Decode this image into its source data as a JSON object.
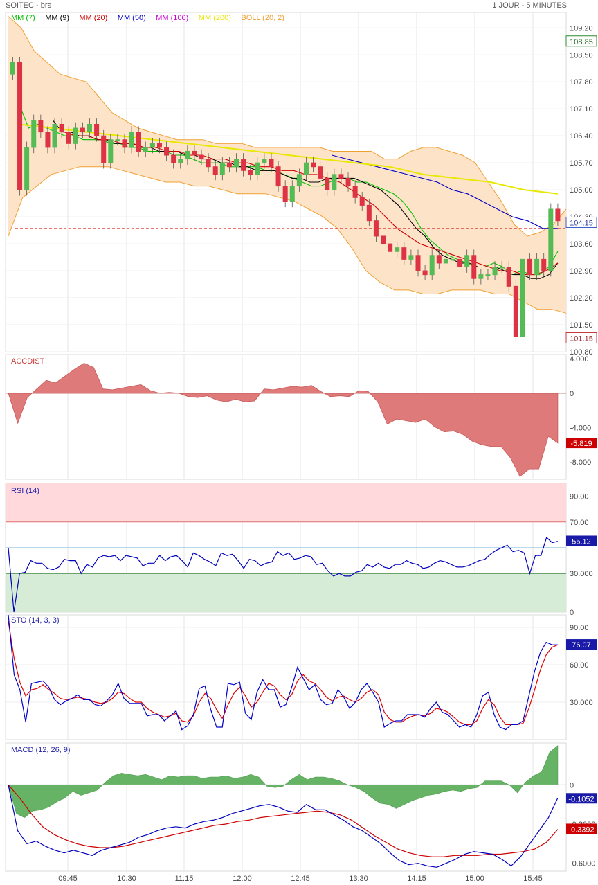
{
  "header": {
    "instrument": "SOITEC - brs",
    "timeframe": "1 JOUR - 5 MINUTES"
  },
  "legend": [
    {
      "label": "MM (7)",
      "color": "#00c000"
    },
    {
      "label": "MM (9)",
      "color": "#000000"
    },
    {
      "label": "MM (20)",
      "color": "#d00000"
    },
    {
      "label": "MM (50)",
      "color": "#0000c0"
    },
    {
      "label": "MM (100)",
      "color": "#d000d0"
    },
    {
      "label": "MM (200)",
      "color": "#e8e800"
    },
    {
      "label": "BOLL (20, 2)",
      "color": "#f0a030"
    }
  ],
  "colors": {
    "up": "#55bb55",
    "down": "#dd3344",
    "bollinger_fill": "#fde3c8",
    "bollinger_line": "#f0a030",
    "accdist_fill": "#df7a7a",
    "rsi_line": "#0000bb",
    "rsi_over": "#ffd9dc",
    "rsi_under": "#d6ecd6",
    "stoch_k": "#0000cc",
    "stoch_d": "#dd0000",
    "macd_hist": "#66b366",
    "macd_line": "#0000bb",
    "macd_signal": "#cc0000"
  },
  "chart_data": {
    "type": "line",
    "time_labels": [
      "09:45",
      "10:30",
      "11:15",
      "12:00",
      "12:45",
      "13:30",
      "14:15",
      "15:00",
      "15:45"
    ],
    "price_panel": {
      "ylim": [
        100.8,
        109.6
      ],
      "ticks": [
        "109.20",
        "108.50",
        "107.80",
        "107.10",
        "106.40",
        "105.70",
        "105.00",
        "104.30",
        "103.60",
        "102.90",
        "102.20",
        "101.50",
        "100.80"
      ],
      "last_price": "108.85",
      "current_price": "104.15",
      "low_marker": "101.15",
      "reference_level": 104.0,
      "close_series": [
        108.3,
        105.0,
        106.1,
        106.8,
        106.5,
        106.1,
        106.7,
        106.5,
        106.2,
        106.6,
        106.5,
        106.7,
        106.4,
        105.7,
        106.3,
        106.3,
        106.1,
        106.5,
        106.0,
        106.1,
        106.2,
        106.1,
        105.9,
        105.7,
        105.8,
        106.0,
        105.9,
        105.8,
        105.6,
        105.4,
        105.7,
        105.6,
        105.8,
        105.5,
        105.4,
        105.7,
        105.8,
        105.6,
        105.1,
        104.7,
        105.1,
        105.4,
        105.7,
        105.6,
        105.3,
        105.0,
        105.4,
        105.3,
        105.1,
        104.8,
        104.6,
        104.2,
        103.8,
        103.6,
        103.4,
        103.5,
        103.2,
        103.3,
        102.9,
        102.8,
        103.3,
        103.1,
        103.2,
        103.2,
        103.0,
        103.3,
        102.7,
        102.8,
        102.8,
        103.0,
        103.0,
        102.5,
        101.2,
        103.2,
        102.8,
        103.2,
        102.9,
        104.5,
        104.2
      ],
      "moving_averages": {
        "MM (7)": [
          107.2,
          106.6,
          106.7,
          106.6,
          106.5,
          106.4,
          106.4,
          106.3,
          106.3,
          106.3,
          106.2,
          106.2,
          106.1,
          106.1,
          106.0,
          106.0,
          106.0,
          105.9,
          105.9,
          105.8,
          105.7,
          105.7,
          105.7,
          105.6,
          105.6,
          105.6,
          105.6,
          105.5,
          105.5,
          105.4,
          105.3,
          105.2,
          105.1,
          105.1,
          105.2,
          105.3,
          105.3,
          105.2,
          105.2,
          105.1,
          105.0,
          104.9,
          104.7,
          104.4,
          104.0,
          103.7,
          103.5,
          103.3,
          103.2,
          103.1,
          103.0,
          103.0,
          103.1,
          103.0,
          102.8,
          102.9,
          102.8,
          102.8,
          103.0,
          103.4
        ],
        "MM (9)": [
          106.8,
          106.5,
          106.5,
          106.4,
          106.4,
          106.3,
          106.3,
          106.2,
          106.2,
          106.2,
          106.1,
          106.1,
          106.0,
          106.0,
          106.0,
          105.9,
          105.9,
          105.8,
          105.8,
          105.7,
          105.7,
          105.6,
          105.6,
          105.5,
          105.5,
          105.5,
          105.4,
          105.3,
          105.3,
          105.2,
          105.2,
          105.3,
          105.3,
          105.3,
          105.3,
          105.2,
          105.1,
          105.0,
          104.8,
          104.6,
          104.3,
          104.0,
          103.8,
          103.5,
          103.3,
          103.2,
          103.1,
          103.1,
          103.0,
          103.0,
          103.0,
          102.9,
          102.8,
          102.8,
          102.7,
          102.7,
          102.8,
          103.1
        ],
        "MM (20)": [
          106.5,
          106.4,
          106.4,
          106.3,
          106.3,
          106.2,
          106.2,
          106.1,
          106.1,
          106.0,
          106.0,
          105.9,
          105.9,
          105.8,
          105.8,
          105.7,
          105.7,
          105.6,
          105.6,
          105.5,
          105.5,
          105.4,
          105.4,
          105.3,
          105.2,
          105.0,
          104.8,
          104.6,
          104.3,
          104.0,
          103.8,
          103.6,
          103.5,
          103.4,
          103.3,
          103.2,
          103.1,
          103.0,
          102.9,
          102.9,
          102.8,
          102.8,
          102.9,
          103.1
        ],
        "MM (50)": [
          105.9,
          105.8,
          105.7,
          105.6,
          105.5,
          105.4,
          105.3,
          105.2,
          105.0,
          104.9,
          104.7,
          104.5,
          104.3,
          104.2,
          104.0,
          104.0
        ],
        "MM (200)": [
          106.7,
          106.6,
          106.5,
          106.4,
          106.3,
          106.2,
          106.1,
          106.0,
          105.9,
          105.8,
          105.7,
          105.6,
          105.4,
          105.3,
          105.2,
          105.0,
          104.9
        ]
      },
      "bollinger": {
        "upper": [
          109.5,
          109.2,
          108.6,
          108.3,
          108.0,
          107.9,
          107.8,
          107.4,
          107.0,
          106.8,
          106.6,
          106.5,
          106.4,
          106.3,
          106.3,
          106.3,
          106.2,
          106.2,
          106.2,
          106.1,
          106.1,
          106.1,
          106.1,
          106.1,
          106.1,
          106.0,
          106.0,
          106.0,
          106.0,
          105.8,
          105.8,
          106.0,
          106.1,
          106.1,
          106.0,
          105.9,
          105.7,
          105.2,
          104.7,
          104.1,
          103.8,
          103.9,
          104.1,
          104.5
        ],
        "lower": [
          103.8,
          104.8,
          105.1,
          105.4,
          105.5,
          105.6,
          105.6,
          105.6,
          105.5,
          105.4,
          105.3,
          105.2,
          105.2,
          105.1,
          105.1,
          105.0,
          104.9,
          104.9,
          104.9,
          104.8,
          104.7,
          104.5,
          104.3,
          104.0,
          103.5,
          102.9,
          102.6,
          102.4,
          102.4,
          102.3,
          102.3,
          102.4,
          102.4,
          102.4,
          102.3,
          102.3,
          102.1,
          101.9,
          101.9,
          101.8
        ]
      }
    },
    "accdist_panel": {
      "title": "ACCDIST",
      "ticks": [
        "4.000",
        "0",
        "-4.000",
        "-8.000"
      ],
      "ylim": [
        -10.0,
        4.5
      ],
      "last_value": "-5.819",
      "values": [
        0,
        -3.5,
        -0.5,
        0.5,
        1.5,
        1.2,
        2.0,
        2.8,
        3.5,
        3.0,
        0.5,
        0.4,
        0.6,
        0.8,
        1.0,
        0.3,
        0.0,
        0.1,
        0.0,
        -0.4,
        -0.5,
        -0.3,
        -0.8,
        -1.0,
        -0.7,
        -1.0,
        -0.9,
        0.5,
        0.4,
        0.6,
        0.8,
        0.7,
        0.9,
        0.2,
        -0.4,
        -0.3,
        -0.4,
        0.3,
        0.2,
        -1.0,
        -3.6,
        -3.0,
        -3.2,
        -3.4,
        -3.0,
        -3.9,
        -4.5,
        -4.4,
        -4.8,
        -5.6,
        -6.0,
        -6.2,
        -6.2,
        -7.5,
        -9.7,
        -8.8,
        -8.8,
        -5.0,
        -5.8
      ]
    },
    "rsi_panel": {
      "title": "RSI (14)",
      "ticks": [
        "90.00",
        "70.00",
        "30.000",
        "0"
      ],
      "ylim": [
        0,
        100
      ],
      "overbought": 70,
      "oversold": 30,
      "last_value": "55.12",
      "values": [
        50,
        0,
        30,
        31,
        40,
        38,
        38,
        34,
        33,
        35,
        41,
        40,
        40,
        30,
        37,
        35,
        42,
        44,
        43,
        44,
        40,
        44,
        43,
        42,
        36,
        38,
        38,
        44,
        40,
        43,
        44,
        40,
        35,
        46,
        44,
        41,
        39,
        36,
        46,
        44,
        45,
        40,
        34,
        41,
        40,
        36,
        38,
        39,
        47,
        44,
        46,
        41,
        42,
        44,
        43,
        37,
        38,
        32,
        28,
        30,
        28,
        28,
        31,
        32,
        37,
        35,
        38,
        35,
        34,
        37,
        37,
        40,
        38,
        37,
        34,
        35,
        38,
        40,
        39,
        37,
        35,
        35,
        36,
        38,
        40,
        41,
        45,
        48,
        50,
        52,
        47,
        48,
        46,
        30,
        44,
        44,
        58,
        54,
        55
      ],
      "values_note_sampled": true
    },
    "stoch_panel": {
      "title": "STO (14, 3, 3)",
      "ticks": [
        "90.00",
        "60.00",
        "30.000"
      ],
      "ylim": [
        0,
        100
      ],
      "last_value": "76.07",
      "k_values": [
        100,
        52,
        40,
        14,
        45,
        46,
        47,
        42,
        32,
        28,
        31,
        33,
        36,
        32,
        32,
        28,
        27,
        31,
        36,
        45,
        33,
        29,
        29,
        29,
        19,
        20,
        20,
        15,
        19,
        23,
        8,
        11,
        20,
        41,
        43,
        24,
        10,
        10,
        45,
        44,
        46,
        21,
        16,
        38,
        48,
        40,
        40,
        26,
        28,
        42,
        58,
        49,
        40,
        44,
        32,
        28,
        29,
        40,
        34,
        25,
        30,
        40,
        45,
        38,
        30,
        10,
        13,
        15,
        15,
        20,
        20,
        20,
        18,
        25,
        30,
        22,
        20,
        15,
        10,
        12,
        10,
        20,
        35,
        38,
        20,
        10,
        8,
        12,
        12,
        15,
        35,
        55,
        70,
        78,
        76,
        76
      ],
      "d_values": [
        95,
        65,
        46,
        35,
        40,
        41,
        44,
        40,
        37,
        33,
        32,
        33,
        34,
        33,
        32,
        30,
        29,
        30,
        33,
        38,
        37,
        33,
        30,
        30,
        25,
        22,
        20,
        18,
        19,
        21,
        15,
        14,
        19,
        30,
        37,
        33,
        24,
        17,
        28,
        37,
        42,
        35,
        26,
        30,
        38,
        45,
        43,
        36,
        32,
        36,
        47,
        52,
        47,
        45,
        40,
        34,
        31,
        34,
        35,
        32,
        30,
        33,
        38,
        40,
        36,
        22,
        16,
        14,
        14,
        17,
        19,
        20,
        19,
        21,
        25,
        24,
        22,
        18,
        14,
        12,
        12,
        15,
        25,
        32,
        28,
        18,
        12,
        12,
        12,
        13,
        25,
        40,
        56,
        68,
        74,
        76
      ]
    },
    "macd_panel": {
      "title": "MACD (12, 26, 9)",
      "ticks": [
        "0",
        "-0.3000",
        "-0.6000"
      ],
      "ylim": [
        -0.66,
        0.32
      ],
      "last_macd": "-0.1052",
      "last_signal": "-0.3392",
      "macd_values": [
        0,
        -0.35,
        -0.45,
        -0.43,
        -0.47,
        -0.5,
        -0.52,
        -0.5,
        -0.52,
        -0.54,
        -0.5,
        -0.48,
        -0.46,
        -0.44,
        -0.4,
        -0.38,
        -0.35,
        -0.33,
        -0.32,
        -0.33,
        -0.3,
        -0.28,
        -0.27,
        -0.25,
        -0.22,
        -0.2,
        -0.18,
        -0.16,
        -0.15,
        -0.17,
        -0.2,
        -0.21,
        -0.15,
        -0.19,
        -0.19,
        -0.23,
        -0.27,
        -0.32,
        -0.35,
        -0.4,
        -0.45,
        -0.52,
        -0.58,
        -0.61,
        -0.6,
        -0.62,
        -0.63,
        -0.6,
        -0.57,
        -0.53,
        -0.51,
        -0.52,
        -0.53,
        -0.57,
        -0.62,
        -0.55,
        -0.45,
        -0.35,
        -0.25,
        -0.1
      ],
      "signal_values": [
        0,
        -0.1,
        -0.22,
        -0.32,
        -0.38,
        -0.42,
        -0.45,
        -0.47,
        -0.48,
        -0.48,
        -0.47,
        -0.45,
        -0.43,
        -0.41,
        -0.39,
        -0.37,
        -0.35,
        -0.33,
        -0.31,
        -0.3,
        -0.28,
        -0.27,
        -0.25,
        -0.24,
        -0.23,
        -0.22,
        -0.21,
        -0.2,
        -0.21,
        -0.23,
        -0.27,
        -0.33,
        -0.39,
        -0.44,
        -0.49,
        -0.52,
        -0.54,
        -0.55,
        -0.55,
        -0.54,
        -0.54,
        -0.54,
        -0.53,
        -0.53,
        -0.52,
        -0.51,
        -0.49,
        -0.44,
        -0.34
      ],
      "hist_values": [
        0,
        -0.22,
        -0.25,
        -0.2,
        -0.19,
        -0.17,
        -0.13,
        -0.1,
        -0.05,
        -0.08,
        -0.06,
        -0.04,
        0.02,
        0.07,
        0.09,
        0.08,
        0.07,
        0.08,
        0.06,
        0.04,
        0.07,
        0.06,
        0.07,
        0.07,
        0.05,
        0.06,
        0.06,
        0.07,
        0.05,
        0.06,
        0.08,
        0.06,
        -0.01,
        -0.02,
        -0.01,
        0.04,
        0.08,
        0.04,
        0.06,
        0.06,
        0.05,
        0.03,
        0.0,
        -0.02,
        -0.05,
        -0.1,
        -0.14,
        -0.15,
        -0.18,
        -0.15,
        -0.12,
        -0.1,
        -0.08,
        -0.07,
        -0.05,
        -0.04,
        -0.05,
        -0.03,
        -0.02,
        0.03,
        0.03,
        0.03,
        0.0,
        -0.06,
        0.02,
        0.07,
        0.1,
        0.25,
        0.3
      ]
    }
  }
}
